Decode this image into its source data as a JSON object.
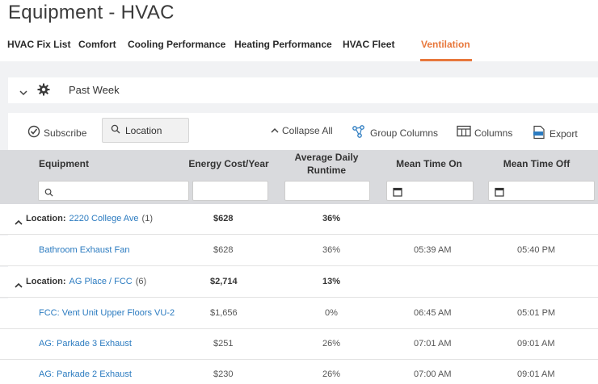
{
  "page": {
    "title": "Equipment - HVAC"
  },
  "tabs": [
    {
      "label": "HVAC Fix List",
      "active": false
    },
    {
      "label": "Comfort",
      "active": false
    },
    {
      "label": "Cooling Performance",
      "active": false
    },
    {
      "label": "Heating Performance",
      "active": false
    },
    {
      "label": "HVAC Fleet",
      "active": false
    },
    {
      "label": "Ventilation",
      "active": true
    }
  ],
  "filter": {
    "period": "Past Week"
  },
  "toolbar": {
    "subscribe": "Subscribe",
    "search_value": "Location",
    "collapse_all": "Collapse All",
    "group_columns": "Group Columns",
    "columns": "Columns",
    "export": "Export"
  },
  "columns": {
    "equipment": "Equipment",
    "energy_cost": "Energy Cost/Year",
    "avg_runtime_1": "Average Daily",
    "avg_runtime_2": "Runtime",
    "mean_on": "Mean Time On",
    "mean_off": "Mean Time Off"
  },
  "groups": [
    {
      "label": "Location:",
      "name": "2220 College Ave",
      "count": "(1)",
      "energy": "$628",
      "runtime": "36%"
    },
    {
      "label": "Location:",
      "name": "AG Place / FCC",
      "count": "(6)",
      "energy": "$2,714",
      "runtime": "13%"
    }
  ],
  "rows": [
    {
      "equipment": "Bathroom Exhaust Fan",
      "energy": "$628",
      "runtime": "36%",
      "on": "05:39 AM",
      "off": "05:40 PM"
    },
    {
      "equipment": "FCC: Vent Unit Upper Floors VU-2",
      "energy": "$1,656",
      "runtime": "0%",
      "on": "06:45 AM",
      "off": "05:01 PM"
    },
    {
      "equipment": "AG: Parkade 3 Exhaust",
      "energy": "$251",
      "runtime": "26%",
      "on": "07:01 AM",
      "off": "09:01 AM"
    },
    {
      "equipment": "AG: Parkade 2 Exhaust",
      "energy": "$230",
      "runtime": "26%",
      "on": "07:00 AM",
      "off": "09:01 AM"
    }
  ],
  "colors": {
    "accent": "#e8783c",
    "link": "#2b7bc0",
    "header_bg": "#d9dadd"
  }
}
